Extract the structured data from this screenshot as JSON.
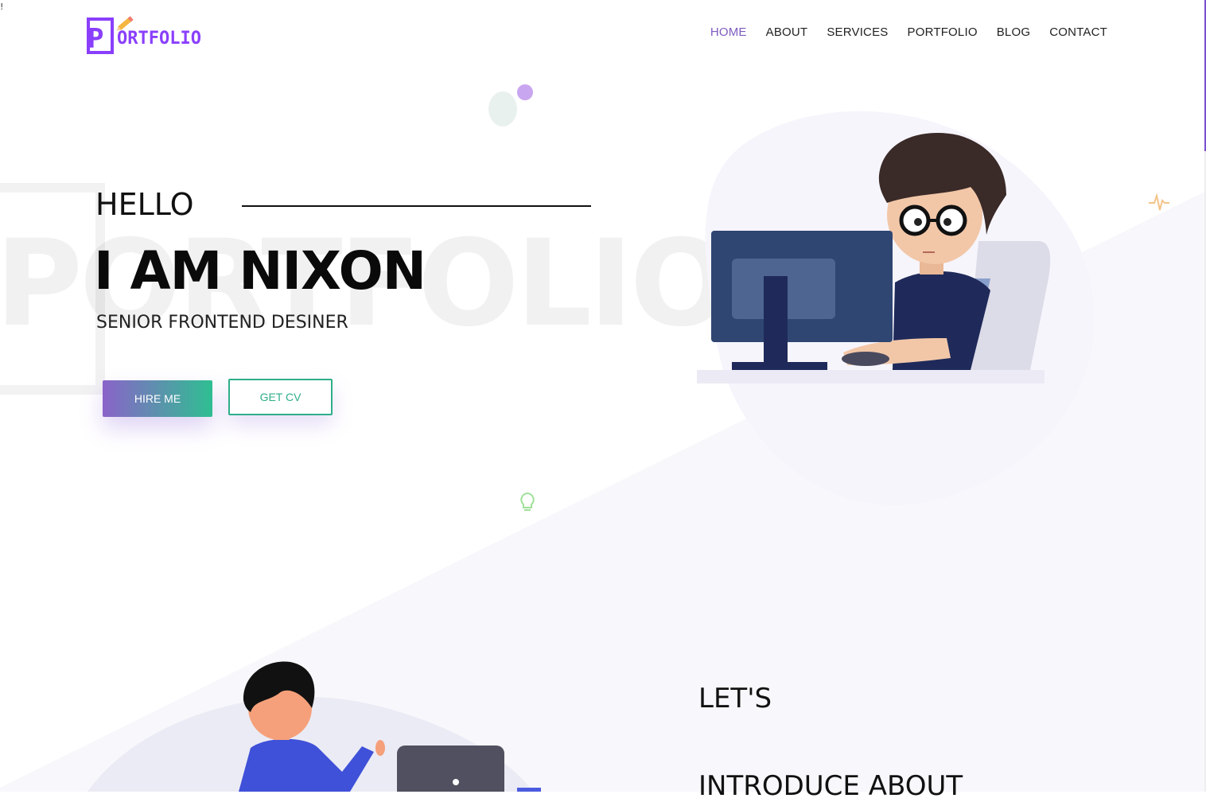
{
  "corner_mark": "!",
  "logo": {
    "text": "ORTFOLIO",
    "letter": "P"
  },
  "nav": {
    "items": [
      {
        "label": "HOME",
        "active": true
      },
      {
        "label": "ABOUT",
        "active": false
      },
      {
        "label": "SERVICES",
        "active": false
      },
      {
        "label": "PORTFOLIO",
        "active": false
      },
      {
        "label": "BLOG",
        "active": false
      },
      {
        "label": "CONTACT",
        "active": false
      }
    ]
  },
  "hero": {
    "watermark": "PORTFOLIO",
    "greeting": "HELLO",
    "name": "I AM NIXON",
    "role": "SENIOR FRONTEND DESINER",
    "hire_label": "HIRE ME",
    "cv_label": "GET CV"
  },
  "about": {
    "heading": "LET'S",
    "subheading": "INTRODUCE ABOUT"
  },
  "colors": {
    "accent": "#7e5bbf",
    "logo": "#8a3ffc",
    "teal": "#2fae8a",
    "gradient_start": "#8a63c9",
    "gradient_end": "#2fbf92"
  },
  "icons": [
    "pencil-icon",
    "pulse-icon",
    "lightbulb-icon"
  ]
}
